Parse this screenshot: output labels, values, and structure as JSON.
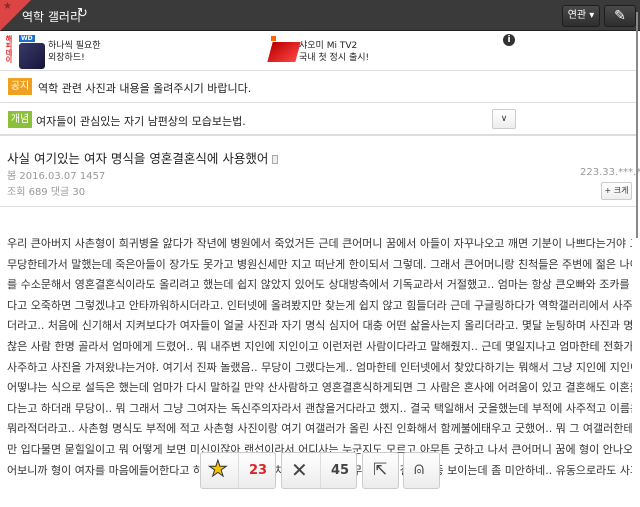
{
  "header": {
    "title": "역학 갤러리",
    "related_label": "연관",
    "related_caret": "▾"
  },
  "ads": [
    {
      "brand": "WD",
      "text1": "하나씩 필요한",
      "text2": "외장하드!"
    },
    {
      "brand": "mi",
      "text1": "샤오미 Mi TV2",
      "text2": "국내 첫 정시 출시!"
    }
  ],
  "ad_side_label": "해피데이",
  "notice": {
    "badge": "공지",
    "text": "역학 관련 사진과 내용을 올려주시기 바랍니다.",
    "color": "#f0a020"
  },
  "concept": {
    "badge": "개념",
    "text": "여자들이 관심있는 자기 남편상의 모습보는법.",
    "color": "#8cbf3a"
  },
  "post": {
    "title": "사실 여기있는 여자 명식을 영혼결혼식에 사용했어",
    "author_line": "봄 2016.03.07 1457",
    "stats": "조회 689 댓글 30",
    "ip": "223.33.***.**",
    "zoom_label": "+ 크게",
    "body_lines": [
      "우리 큰아버지 사촌형이 희귀병을 앓다가 작년에 병원에서 죽었거든 근데 큰어머니 꿈에서 아들이 자꾸나오고 깨면 기분이 나쁘다는거야 그래서 용하다는",
      "무당한테가서 말했는데 죽은아들이 장가도 못가고 병원신세만 지고 떠난게 한이되서 그렇데. 그래서 큰어머니랑 친척들은 주변에 젊은 나이에 죽은 아가씨",
      "를 수소문해서 영혼결혼식이라도 올리려고 했는데 쉽지 않았지 있어도 상대방측에서 기독교라서 거절했고.. 엄마는 항상 큰오빠와 조카를 생각하면 불쌍하",
      "다고 오죽하면 그렇겠냐고 안타까워하시더라고. 인터넷에 올려봤지만 찾는게 쉽지 않고 힘들더라 근데 구글링하다가 역학갤러리에서 사주 명식이 많이 돌",
      "더라고.. 처음에 신기해서 지켜보다가 여자들이 얼굴 사진과 자기 명식 심지어 대충 어떤 삶을사는지 올리더라고. 몇달 눈팅하며 사진과 명식을 모아두고 괜",
      "찮은 사람 한명 골라서 엄마에게 드렸어.. 뭐 내주변 지인에 지인이고 이런저런 사람이다라고 말해줬지.. 근데 몇일지나고 엄마한테 전화가 왔는데 왜 산사람",
      "사주하고 사진을 가져왔냐는거야. 여기서 진짜 놀랬음.. 무당이 그랬다는게.. 엄마한테 인터넷에서 찾았다하기는 뭐해서 그냥 지인에 지인이고 뭐 미신인데",
      "어떻냐는 식으로 설득은 했는데 엄마가 다시 말하길 만약 산사람하고 영혼결혼식하게되면 그 사람은 혼사에 어려움이 있고 결혼해도 이혼을 여러번하게 된",
      "다는고 하더래 무당이.. 뭐 그래서 그냥 그여자는 독신주의자라서 괜찮을거다라고 했지.. 결국 택일해서 굿을했는데 부적에 사주적고 이름은 무당이 한문으로",
      "뭐라적더라고.. 사촌형 명식도 부적에 적고 사촌형 사진이랑 여기 여갤러가 올린 사진 인화해서 함께불에태우고 굿했어.. 뭐 그 여갤러한테 미안하긴한데 나",
      "만 입다물면 묻힐일이고 뭐 어떻게 보면 미신이잖아 랜선이라서 어디사는 누군지도 모르고 아무튼 굿하고 나서 큰어머니 꿈에 형이 안나오더래 무당한테 물",
      "어보니까 형이 여자를 마음에들어한다고 하더라고.. 소름끼치고 신기하다 아무튼 그 여갤러 종종 보이는데 좀 미안하네.. 유동으로라도 사과하고 싶어"
    ]
  },
  "actions": {
    "recommend_count": "23",
    "unrecommend_count": "45",
    "recommend_color": "#d9262b"
  }
}
